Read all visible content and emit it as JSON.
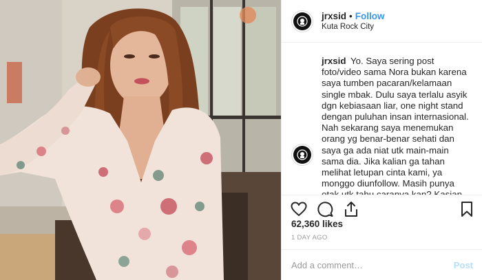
{
  "post": {
    "username": "jrxsid",
    "separator": "•",
    "follow_label": "Follow",
    "location": "Kuta Rock City",
    "caption": "Yo. Saya sering post foto/video sama Nora bukan karena saya tumben pacaran/kelamaan single mbak. Dulu saya terlalu asyik dgn kebiasaan liar, one night stand dengan puluhan insan internasional. Nah sekarang saya menemukan orang yg benar-benar sehati dan saya ga ada niat utk main-main sama dia. Jika kalian ga tahan melihat letupan cinta kami, ya monggo diunfollow. Masih punya otak utk tahu caranya kan? Kasian hanya bisa bengong dan kelakar.",
    "likes": "62,360 likes",
    "timestamp": "1 DAY AGO",
    "comment_placeholder": "Add a comment…",
    "post_label": "Post"
  },
  "icons": {
    "like": "heart-icon",
    "comment": "comment-icon",
    "share": "share-icon",
    "save": "bookmark-icon"
  },
  "colors": {
    "follow": "#3897f0",
    "post_disabled": "#b2dffc"
  }
}
